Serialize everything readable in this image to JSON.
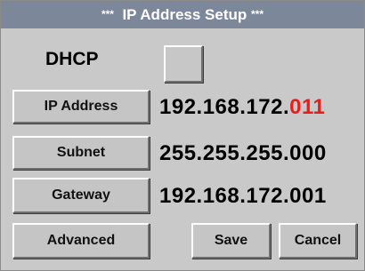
{
  "title": "*** IP Address Setup ***",
  "title_parts": {
    "stars_left": "***",
    "text": "IP Address Setup",
    "stars_right": "***"
  },
  "dhcp": {
    "label": "DHCP",
    "checked": false
  },
  "ip": {
    "button_label": "IP Address",
    "value_prefix": "192.168.172.",
    "value_highlight": "011",
    "highlight_color": "#ee1b1b"
  },
  "subnet": {
    "button_label": "Subnet",
    "value": "255.255.255.000"
  },
  "gateway": {
    "button_label": "Gateway",
    "value": "192.168.172.001"
  },
  "buttons": {
    "advanced": "Advanced",
    "save": "Save",
    "cancel": "Cancel"
  },
  "colors": {
    "background": "#c9c9c9",
    "titlebar": "#7c8799"
  }
}
